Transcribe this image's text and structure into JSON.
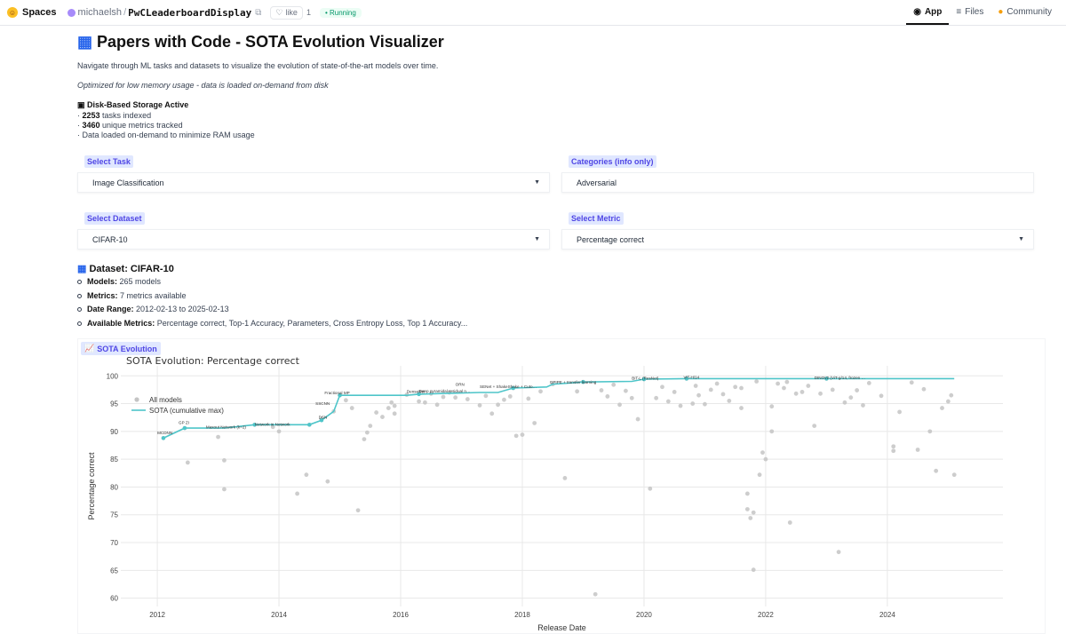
{
  "topbar": {
    "spaces_label": "Spaces",
    "owner": "michaelsh",
    "repo": "PwCLeaderboardDisplay",
    "like_label": "like",
    "like_count": "1",
    "status": "Running",
    "tabs": [
      {
        "label": "App",
        "icon": "app-icon",
        "active": true
      },
      {
        "label": "Files",
        "icon": "files-icon",
        "active": false
      },
      {
        "label": "Community",
        "icon": "community-icon",
        "active": false
      }
    ]
  },
  "main": {
    "title_icon": "bar-chart-icon",
    "title": "Papers with Code - SOTA Evolution Visualizer",
    "description": "Navigate through ML tasks and datasets to visualize the evolution of state-of-the-art models over time.",
    "note": "Optimized for low memory usage - data is loaded on-demand from disk",
    "storage": {
      "heading": "Disk-Based Storage Active",
      "tasks_count": "2253",
      "tasks_text": "tasks indexed",
      "metrics_count": "3460",
      "metrics_text": "unique metrics tracked",
      "ondemand_text": "Data loaded on-demand to minimize RAM usage"
    },
    "controls": {
      "task": {
        "label": "Select Task",
        "value": "Image Classification"
      },
      "categories": {
        "label": "Categories (info only)",
        "value": "Adversarial"
      },
      "dataset": {
        "label": "Select Dataset",
        "value": "CIFAR-10"
      },
      "metric": {
        "label": "Select Metric",
        "value": "Percentage correct"
      }
    },
    "dataset_info": {
      "heading": "Dataset: CIFAR-10",
      "models_label": "Models:",
      "models_value": "265 models",
      "metrics_label": "Metrics:",
      "metrics_value": "7 metrics available",
      "date_label": "Date Range:",
      "date_value": "2012-02-13 to 2025-02-13",
      "available_label": "Available Metrics:",
      "available_value": "Percentage correct, Top-1 Accuracy, Parameters, Cross Entropy Loss, Top 1 Accuracy..."
    },
    "plot_tab": "SOTA Evolution"
  },
  "chart_data": {
    "type": "scatter",
    "title": "SOTA Evolution: Percentage correct",
    "xlabel": "Release Date",
    "ylabel": "Percentage correct",
    "xlim": [
      2011.4,
      2025.9
    ],
    "ylim": [
      58.5,
      101.8
    ],
    "xticks": [
      "2012",
      "2014",
      "2016",
      "2018",
      "2020",
      "2022",
      "2024"
    ],
    "yticks": [
      60,
      65,
      70,
      75,
      80,
      85,
      90,
      95,
      100
    ],
    "grid": true,
    "legend_position": "top-left",
    "legend": [
      "All models",
      "SOTA (cumulative max)"
    ],
    "colors": {
      "all_models": "#c4c4c4",
      "sota": "#4ec5c9"
    },
    "sota_line": [
      [
        2012.1,
        88.8
      ],
      [
        2012.45,
        90.6
      ],
      [
        2013.1,
        90.6
      ],
      [
        2013.6,
        91.2
      ],
      [
        2014.5,
        91.2
      ],
      [
        2014.7,
        92.0
      ],
      [
        2014.9,
        93.6
      ],
      [
        2015.0,
        96.5
      ],
      [
        2016.1,
        96.5
      ],
      [
        2016.3,
        96.7
      ],
      [
        2017.3,
        97.0
      ],
      [
        2017.6,
        97.0
      ],
      [
        2017.85,
        97.8
      ],
      [
        2018.4,
        98.0
      ],
      [
        2018.5,
        98.5
      ],
      [
        2019.0,
        98.9
      ],
      [
        2019.8,
        99.0
      ],
      [
        2020.0,
        99.4
      ],
      [
        2020.7,
        99.5
      ],
      [
        2021.0,
        99.5
      ],
      [
        2023.0,
        99.5
      ],
      [
        2025.1,
        99.5
      ]
    ],
    "sota_points": [
      [
        2012.1,
        88.8
      ],
      [
        2012.45,
        90.6
      ],
      [
        2013.6,
        91.2
      ],
      [
        2014.5,
        91.2
      ],
      [
        2014.7,
        92.0
      ],
      [
        2015.0,
        96.5
      ],
      [
        2016.3,
        96.7
      ],
      [
        2017.85,
        97.8
      ],
      [
        2019.0,
        98.9
      ],
      [
        2020.0,
        99.4
      ],
      [
        2020.7,
        99.5
      ],
      [
        2023.0,
        99.5
      ]
    ],
    "all_models": [
      [
        2012.1,
        88.8
      ],
      [
        2012.45,
        90.6
      ],
      [
        2012.5,
        84.4
      ],
      [
        2013.0,
        89.0
      ],
      [
        2013.1,
        79.6
      ],
      [
        2013.1,
        84.8
      ],
      [
        2013.6,
        91.2
      ],
      [
        2013.9,
        90.8
      ],
      [
        2014.0,
        90.0
      ],
      [
        2014.3,
        78.8
      ],
      [
        2014.45,
        82.2
      ],
      [
        2014.5,
        91.2
      ],
      [
        2014.7,
        92.2
      ],
      [
        2014.8,
        81.0
      ],
      [
        2014.9,
        93.6
      ],
      [
        2015.0,
        96.5
      ],
      [
        2015.1,
        95.6
      ],
      [
        2015.2,
        94.2
      ],
      [
        2015.3,
        75.8
      ],
      [
        2015.4,
        88.6
      ],
      [
        2015.45,
        89.8
      ],
      [
        2015.5,
        91.0
      ],
      [
        2015.6,
        93.4
      ],
      [
        2015.7,
        92.6
      ],
      [
        2015.8,
        94.2
      ],
      [
        2015.85,
        95.2
      ],
      [
        2015.9,
        93.2
      ],
      [
        2015.9,
        94.6
      ],
      [
        2016.1,
        96.6
      ],
      [
        2016.3,
        95.4
      ],
      [
        2016.4,
        95.2
      ],
      [
        2016.5,
        96.8
      ],
      [
        2016.6,
        94.8
      ],
      [
        2016.7,
        96.2
      ],
      [
        2016.8,
        97.0
      ],
      [
        2016.9,
        96.1
      ],
      [
        2017.1,
        95.8
      ],
      [
        2017.3,
        94.7
      ],
      [
        2017.4,
        96.4
      ],
      [
        2017.5,
        93.2
      ],
      [
        2017.6,
        94.8
      ],
      [
        2017.7,
        95.7
      ],
      [
        2017.8,
        96.3
      ],
      [
        2017.85,
        97.8
      ],
      [
        2017.9,
        89.2
      ],
      [
        2018.0,
        89.4
      ],
      [
        2018.1,
        95.9
      ],
      [
        2018.2,
        91.5
      ],
      [
        2018.3,
        97.2
      ],
      [
        2018.5,
        98.5
      ],
      [
        2018.7,
        81.6
      ],
      [
        2018.9,
        97.2
      ],
      [
        2019.0,
        98.9
      ],
      [
        2019.2,
        60.7
      ],
      [
        2019.3,
        97.4
      ],
      [
        2019.4,
        96.3
      ],
      [
        2019.5,
        98.4
      ],
      [
        2019.6,
        94.8
      ],
      [
        2019.7,
        97.3
      ],
      [
        2019.8,
        96.0
      ],
      [
        2019.9,
        92.2
      ],
      [
        2020.0,
        99.4
      ],
      [
        2020.1,
        79.7
      ],
      [
        2020.2,
        96.0
      ],
      [
        2020.3,
        98.0
      ],
      [
        2020.4,
        95.4
      ],
      [
        2020.5,
        97.1
      ],
      [
        2020.6,
        94.6
      ],
      [
        2020.7,
        99.5
      ],
      [
        2020.8,
        95.0
      ],
      [
        2020.85,
        98.2
      ],
      [
        2020.9,
        96.5
      ],
      [
        2021.0,
        94.9
      ],
      [
        2021.1,
        97.5
      ],
      [
        2021.2,
        98.6
      ],
      [
        2021.3,
        96.7
      ],
      [
        2021.4,
        95.5
      ],
      [
        2021.5,
        98.0
      ],
      [
        2021.6,
        94.2
      ],
      [
        2021.6,
        97.8
      ],
      [
        2021.7,
        76.0
      ],
      [
        2021.7,
        78.8
      ],
      [
        2021.75,
        74.4
      ],
      [
        2021.8,
        75.4
      ],
      [
        2021.8,
        65.1
      ],
      [
        2021.85,
        99.0
      ],
      [
        2021.9,
        82.2
      ],
      [
        2021.95,
        86.2
      ],
      [
        2022.0,
        85.0
      ],
      [
        2022.1,
        90.0
      ],
      [
        2022.1,
        94.5
      ],
      [
        2022.2,
        98.6
      ],
      [
        2022.3,
        97.8
      ],
      [
        2022.35,
        98.9
      ],
      [
        2022.4,
        73.6
      ],
      [
        2022.5,
        96.8
      ],
      [
        2022.6,
        97.1
      ],
      [
        2022.7,
        98.2
      ],
      [
        2022.8,
        91.0
      ],
      [
        2022.9,
        96.8
      ],
      [
        2023.0,
        99.5
      ],
      [
        2023.1,
        97.5
      ],
      [
        2023.2,
        68.3
      ],
      [
        2023.3,
        95.2
      ],
      [
        2023.4,
        96.1
      ],
      [
        2023.5,
        97.4
      ],
      [
        2023.6,
        94.7
      ],
      [
        2023.7,
        98.7
      ],
      [
        2023.9,
        96.4
      ],
      [
        2024.1,
        87.3
      ],
      [
        2024.1,
        86.5
      ],
      [
        2024.2,
        93.5
      ],
      [
        2024.4,
        98.8
      ],
      [
        2024.5,
        86.7
      ],
      [
        2024.6,
        97.6
      ],
      [
        2024.7,
        90.0
      ],
      [
        2024.8,
        82.9
      ],
      [
        2024.9,
        94.2
      ],
      [
        2025.0,
        95.4
      ],
      [
        2025.05,
        96.5
      ],
      [
        2025.1,
        82.2
      ]
    ],
    "annotations": [
      {
        "text": "MCDNN",
        "x": 2012.0,
        "y": 89.5
      },
      {
        "text": "GP ZI",
        "x": 2012.35,
        "y": 91.3
      },
      {
        "text": "Maxout Network (k=2)",
        "x": 2012.8,
        "y": 90.5
      },
      {
        "text": "Network in Network",
        "x": 2013.6,
        "y": 91.0
      },
      {
        "text": "DSN",
        "x": 2014.65,
        "y": 92.3
      },
      {
        "text": "SSCNN",
        "x": 2014.6,
        "y": 94.8
      },
      {
        "text": "Fractional MP",
        "x": 2014.75,
        "y": 96.7
      },
      {
        "text": "DenseNet",
        "x": 2016.1,
        "y": 96.9
      },
      {
        "text": "Deep pyramidal residual n…",
        "x": 2016.3,
        "y": 97.0
      },
      {
        "text": "ORN",
        "x": 2016.9,
        "y": 98.2
      },
      {
        "text": "SENet + ShakeShake + Cuto…",
        "x": 2017.3,
        "y": 97.8
      },
      {
        "text": "GPIPE + transfer learning",
        "x": 2018.45,
        "y": 98.6
      },
      {
        "text": "BiT-L (ResNet)",
        "x": 2019.8,
        "y": 99.3
      },
      {
        "text": "ViT-H/14",
        "x": 2020.65,
        "y": 99.5
      },
      {
        "text": "DINOv2 (ViT-g/14, frozen …",
        "x": 2022.8,
        "y": 99.4
      }
    ]
  }
}
